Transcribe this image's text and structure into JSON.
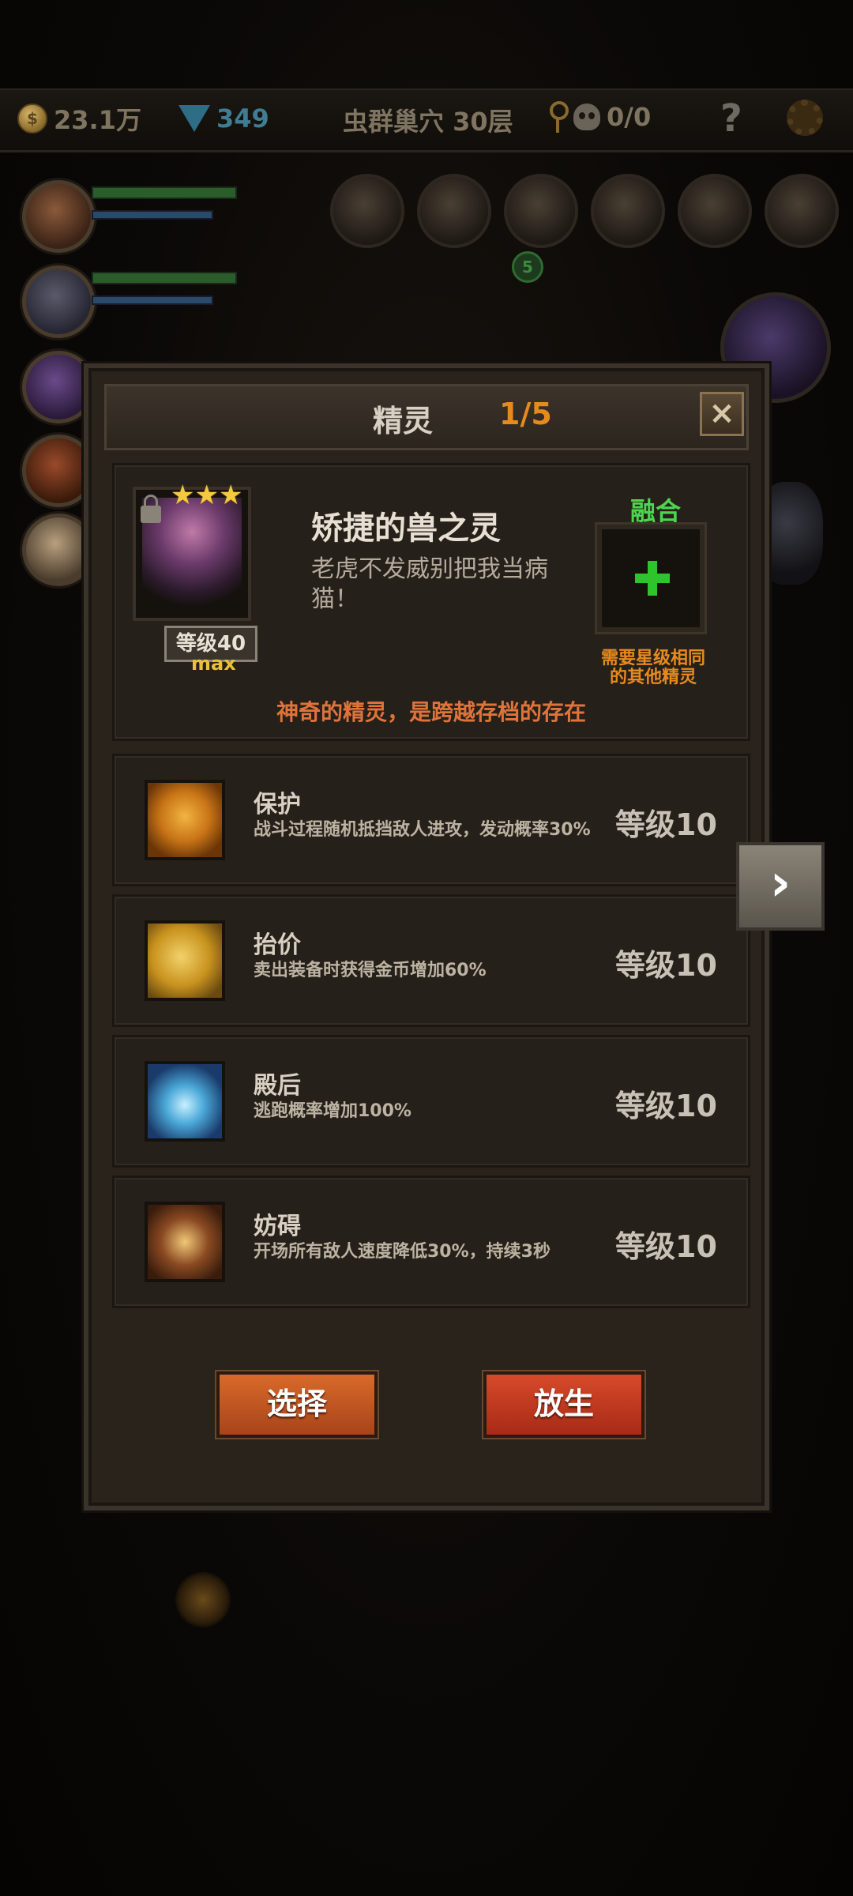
{
  "hud": {
    "gold": "23.1万",
    "gems": "349",
    "location": "虫群巢穴 30层",
    "keys_skulls": "0/0",
    "help": "?"
  },
  "party": {
    "slot_badge": "5"
  },
  "dialog": {
    "title": "精灵",
    "page": "1/5",
    "close": "×",
    "sprite": {
      "stars": "★★★",
      "name": "矫捷的兽之灵",
      "description": "老虎不发威别把我当病猫！",
      "level_label": "等级40",
      "max_label": "max",
      "tagline": "神奇的精灵，是跨越存档的存在"
    },
    "fusion": {
      "label": "融合",
      "note": "需要星级相同的其他精灵"
    },
    "skills": [
      {
        "name": "保护",
        "description": "战斗过程随机抵挡敌人进攻，发动概率30%",
        "level": "等级10",
        "icon": "shield-spirit-icon"
      },
      {
        "name": "抬价",
        "description": "卖出装备时获得金币增加60%",
        "level": "等级10",
        "icon": "hand-icon"
      },
      {
        "name": "殿后",
        "description": "逃跑概率增加100%",
        "level": "等级10",
        "icon": "wings-icon"
      },
      {
        "name": "妨碍",
        "description": "开场所有敌人速度降低30%，持续3秒",
        "level": "等级10",
        "icon": "chained-boot-icon"
      }
    ],
    "buttons": {
      "select": "选择",
      "release": "放生"
    },
    "next": "›"
  },
  "colors": {
    "accent_orange": "#e78a1e",
    "fusion_green": "#4fd44f",
    "star_gold": "#f5c842",
    "button_select": "#c2561f",
    "button_release": "#c23a1f"
  }
}
